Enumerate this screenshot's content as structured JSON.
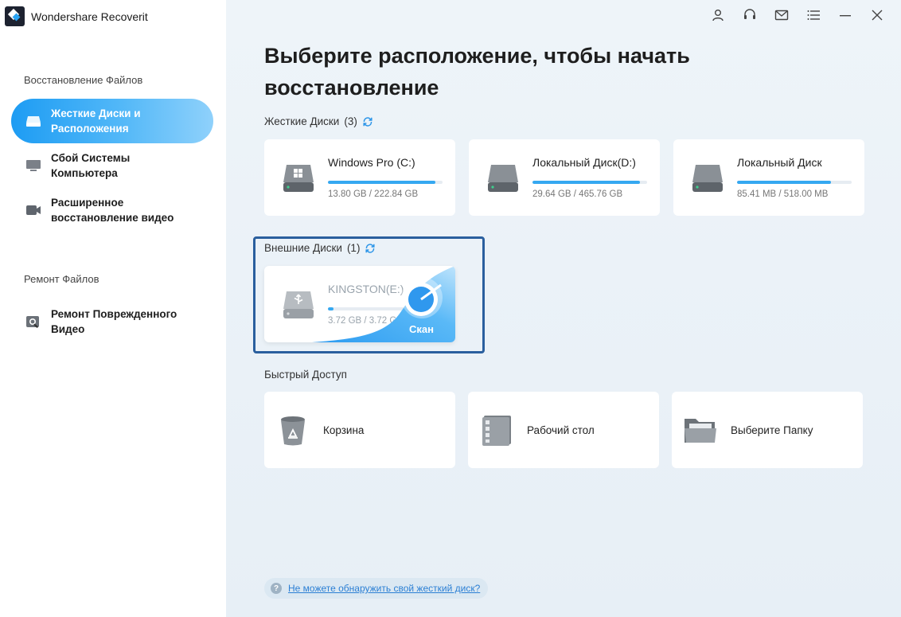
{
  "app": {
    "name": "Wondershare Recoverit"
  },
  "sidebar": {
    "section_recovery": "Восстановление Файлов",
    "section_repair": "Ремонт Файлов",
    "items": [
      {
        "label": "Жесткие Диски и Расположения",
        "active": true
      },
      {
        "label": "Сбой Системы Компьютера",
        "active": false
      },
      {
        "label": "Расширенное восстановление видео",
        "active": false
      },
      {
        "label": "Ремонт Поврежденного Видео",
        "active": false
      }
    ]
  },
  "main": {
    "headline": "Выберите расположение, чтобы начать восстановление",
    "hard_drives": {
      "label": "Жесткие Диски",
      "count": "(3)",
      "drives": [
        {
          "name": "Windows Pro (C:)",
          "size": "13.80 GB / 222.84 GB",
          "used_fraction": 0.94,
          "icon": "windows-drive-icon"
        },
        {
          "name": "Локальный Диск(D:)",
          "size": "29.64 GB / 465.76 GB",
          "used_fraction": 0.94,
          "icon": "hard-drive-icon"
        },
        {
          "name": "Локальный Диск",
          "size": "85.41 MB / 518.00 MB",
          "used_fraction": 0.82,
          "icon": "hard-drive-icon"
        }
      ]
    },
    "external_drives": {
      "label": "Внешние Диски",
      "count": "(1)",
      "drives": [
        {
          "name": "KINGSTON(E:)",
          "size": "3.72 GB / 3.72 GB",
          "used_fraction": 0.05,
          "scan_label": "Скан",
          "icon": "usb-drive-icon"
        }
      ]
    },
    "quick_access": {
      "label": "Быстрый Доступ",
      "items": [
        {
          "label": "Корзина",
          "icon": "recycle-bin-icon"
        },
        {
          "label": "Рабочий стол",
          "icon": "desktop-icon"
        },
        {
          "label": "Выберите Папку",
          "icon": "folder-icon"
        }
      ]
    },
    "help_link": "Не можете обнаружить свой жесткий диск?"
  },
  "colors": {
    "accent": "#1d9cf3",
    "bar": "#35a8f1",
    "frame": "#2a5f9e",
    "link": "#2b7fd4"
  }
}
